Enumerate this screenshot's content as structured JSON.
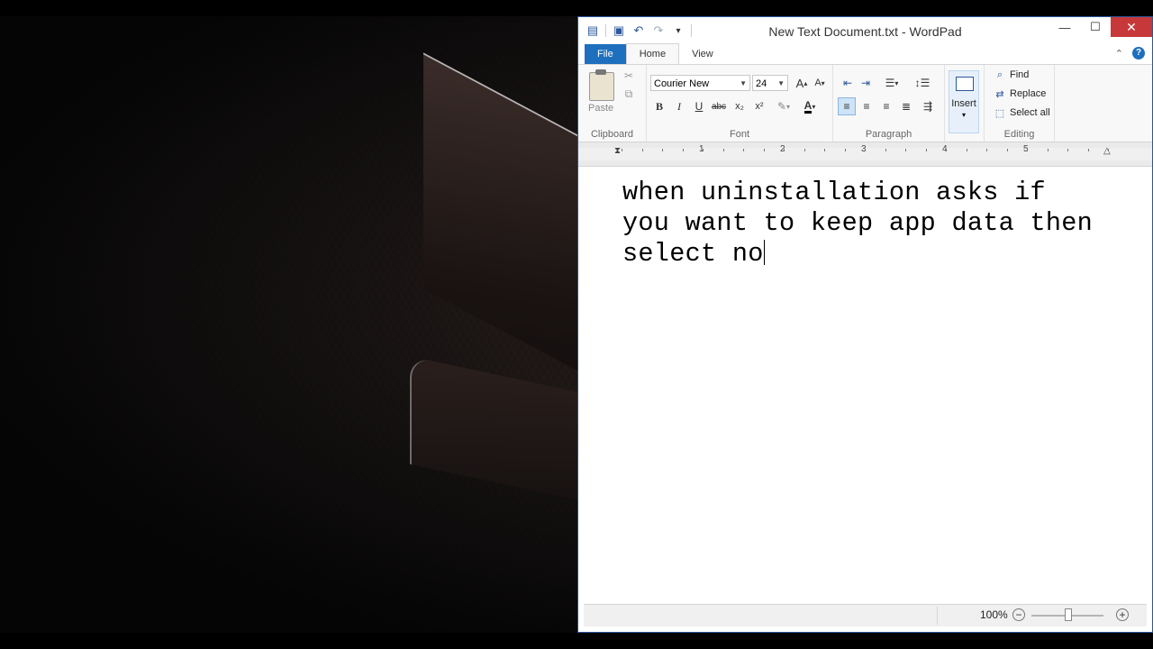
{
  "window": {
    "title": "New Text Document.txt - WordPad",
    "minimize": "—",
    "maximize": "☐",
    "close": "✕"
  },
  "tabs": {
    "file": "File",
    "home": "Home",
    "view": "View"
  },
  "ribbon": {
    "clipboard": {
      "label": "Clipboard",
      "paste": "Paste"
    },
    "font": {
      "label": "Font",
      "family": "Courier New",
      "size": "24",
      "bold": "B",
      "italic": "I",
      "underline": "U",
      "strike": "abc",
      "subscript": "x₂",
      "superscript": "x²",
      "grow": "A",
      "shrink": "A",
      "color": "A"
    },
    "paragraph": {
      "label": "Paragraph"
    },
    "insert": {
      "label": "Insert"
    },
    "editing": {
      "label": "Editing",
      "find": "Find",
      "replace": "Replace",
      "select_all": "Select all"
    }
  },
  "ruler": {
    "numbers": [
      "1",
      "2",
      "3",
      "4",
      "5"
    ]
  },
  "document": {
    "text": "when uninstallation asks if\nyou want to keep app data then\nselect no"
  },
  "status": {
    "zoom": "100%",
    "zoom_out": "−",
    "zoom_in": "+"
  }
}
